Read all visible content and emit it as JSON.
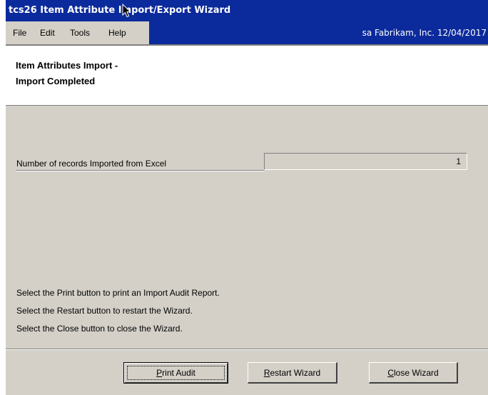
{
  "window": {
    "title": "tcs26 Item Attribute Import/Export Wizard"
  },
  "menu": {
    "file": "File",
    "edit": "Edit",
    "tools": "Tools",
    "help": "Help"
  },
  "company_info": "sa  Fabrikam, Inc.  12/04/2017",
  "header": {
    "line1": "Item Attributes Import -",
    "line2": "Import Completed"
  },
  "records": {
    "label": "Number of records Imported from Excel",
    "value": "1"
  },
  "instructions": [
    "Select the Print button to print an Import Audit Report.",
    "Select the Restart button to restart the Wizard.",
    "Select the Close button to close the Wizard."
  ],
  "buttons": {
    "print": {
      "mnemonic": "P",
      "rest": "rint Audit"
    },
    "restart": {
      "mnemonic": "R",
      "rest": "estart Wizard"
    },
    "close": {
      "mnemonic": "C",
      "rest": "lose Wizard"
    }
  },
  "colors": {
    "title_bar": "#0b2a9c",
    "window_face": "#d4d0c8",
    "header_panel": "#ffffff"
  },
  "icons": {
    "cursor": "mouse-cursor-icon"
  }
}
